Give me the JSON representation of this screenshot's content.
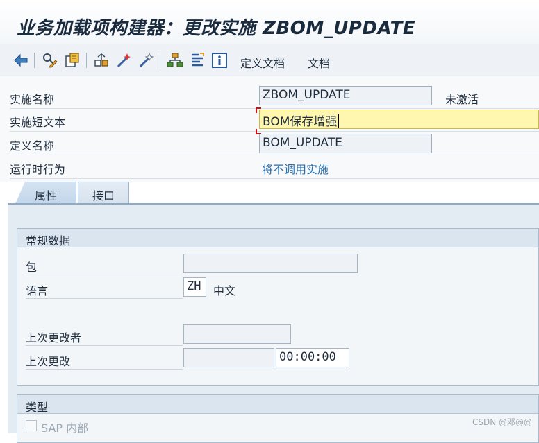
{
  "title": "业务加载项构建器：更改实施 ZBOM_UPDATE",
  "toolbar": {
    "icons": [
      "back-icon",
      "display-change-icon",
      "other-object-icon",
      "check-icon",
      "activate-icon",
      "deactivate-icon",
      "hierarchy-icon",
      "list-icon",
      "info-icon"
    ],
    "definition_docs_label": "定义文档",
    "docs_label": "文档"
  },
  "header": {
    "impl_name_label": "实施名称",
    "impl_name_value": "ZBOM_UPDATE",
    "status_text": "未激活",
    "short_text_label": "实施短文本",
    "short_text_value": "BOM保存增强",
    "def_name_label": "定义名称",
    "def_name_value": "BOM_UPDATE",
    "runtime_label": "运行时行为",
    "runtime_value": "将不调用实施"
  },
  "tabs": [
    {
      "label": "属性",
      "active": true
    },
    {
      "label": "接口",
      "active": false
    }
  ],
  "general": {
    "title": "常规数据",
    "package_label": "包",
    "package_value": "",
    "language_label": "语言",
    "language_code": "ZH",
    "language_name": "中文",
    "last_changed_by_label": "上次更改者",
    "last_changed_by_value": "",
    "last_changed_label": "上次更改",
    "last_changed_date": "",
    "last_changed_time": "00:00:00"
  },
  "type": {
    "title": "类型",
    "sap_internal_label": "SAP 内部"
  },
  "watermark": "CSDN @邓@@"
}
